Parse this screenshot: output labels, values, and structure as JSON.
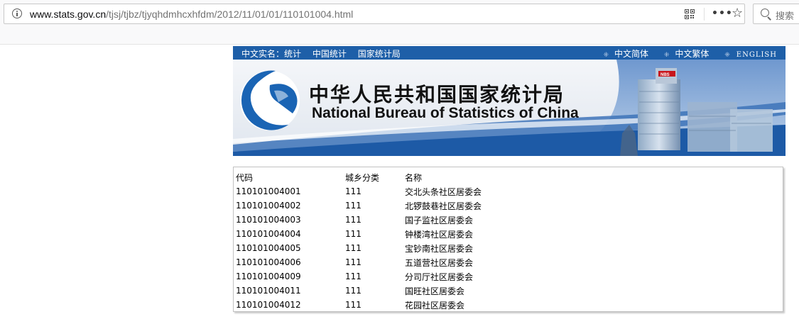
{
  "browser": {
    "url_host": "www.stats.gov.cn",
    "url_path": "/tjsj/tjbz/tjyqhdmhcxhfdm/2012/11/01/01/110101004.html",
    "search_placeholder": "搜索",
    "more_label": "•••",
    "icons": [
      "info-icon",
      "qr-code-icon",
      "more-icon",
      "star-icon",
      "search-icon"
    ]
  },
  "nav": {
    "left": [
      "中文实名：统计",
      "中国统计",
      "国家统计局"
    ],
    "right": [
      "中文简体",
      "中文繁体",
      "ENGLISH"
    ]
  },
  "banner": {
    "title_cn": "中华人民共和国国家统计局",
    "title_en": "National Bureau of Statistics of China",
    "building_sign": "NBS"
  },
  "table": {
    "headers": [
      "代码",
      "城乡分类",
      "名称"
    ],
    "rows": [
      [
        "110101004001",
        "111",
        "交北头条社区居委会"
      ],
      [
        "110101004002",
        "111",
        "北锣鼓巷社区居委会"
      ],
      [
        "110101004003",
        "111",
        "国子监社区居委会"
      ],
      [
        "110101004004",
        "111",
        "钟楼湾社区居委会"
      ],
      [
        "110101004005",
        "111",
        "宝钞南社区居委会"
      ],
      [
        "110101004006",
        "111",
        "五道营社区居委会"
      ],
      [
        "110101004009",
        "111",
        "分司厅社区居委会"
      ],
      [
        "110101004011",
        "111",
        "国旺社区居委会"
      ],
      [
        "110101004012",
        "111",
        "花园社区居委会"
      ]
    ]
  },
  "colors": {
    "nav_blue": "#1e5fa8",
    "logo_blue": "#1a64b4",
    "panel_border": "#c2c2c2"
  }
}
